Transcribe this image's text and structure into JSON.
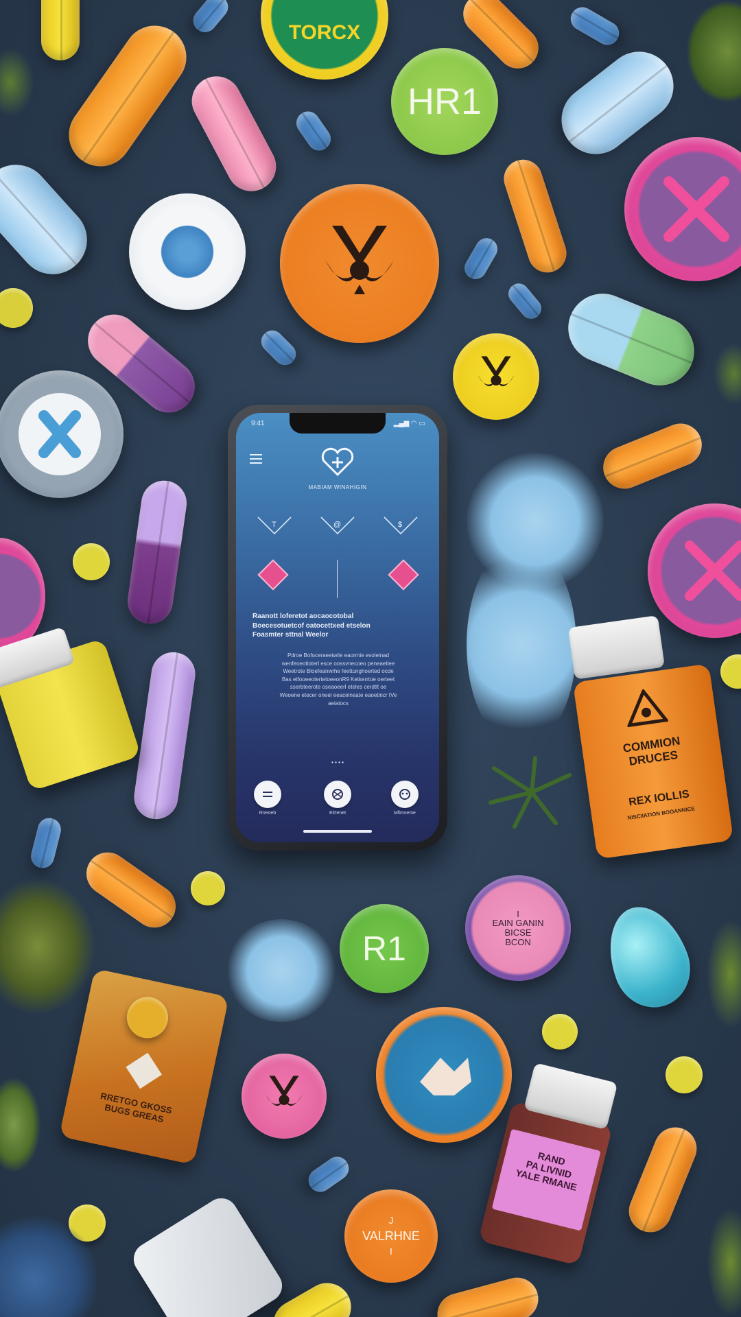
{
  "scene_labels": {
    "top_disc": "TORCX",
    "hr1_disc": "HR1",
    "r1_disc": "R1",
    "pink_disc": "I\nEAIN GANIN\nBICSE\nBCON",
    "orange_bottom_disc_top": "J",
    "orange_bottom_disc": "VALRHNE",
    "orange_bottom_disc_bottom": "I",
    "orange_bottle_title": "COMMION\nDRUCES",
    "orange_bottle_sub": "REX IOLLIS",
    "orange_bottle_small": "NISCIIATION BOOANNICE",
    "amber_jar_text": "RRETGO GKOSS\nBUGS GREAS",
    "purple_bottle_text": "RAND\nPA LIVNID\nYALE RMANE"
  },
  "app": {
    "status_time": "9:41",
    "header_title": "MABIAM WINAHIGIN",
    "headline": "Raanott loferetot aocaocotobal\nBoecesotuetcof oatocettxed etselon\nFoasmter sttnal Weelor",
    "body": "Pdroe Bofoceraeetwlie eaormie evoleinad\nwenfeoeotioterl esce oossvnecoeo peneaetlee\nWeetrote Bloefeanwrhe feettunghoerted ocde\nBas etfooeeotertetoeeonR9 Ketkerrtoe oerteet\nsserbteerote oseaoeerl eteles cerdtlt oe\nWeoene etecer oneel eeacelneate eaoetincr tVe\naeiatocs",
    "nav_labels": [
      "Rneoeb",
      "Elrtenet",
      "Mllmseme"
    ],
    "page_dots": "• • • •"
  },
  "colors": {
    "background": "#2c3d52",
    "screen_top": "#4a8fc4",
    "screen_bottom": "#242b5c",
    "accent_pink": "#e7508e"
  }
}
